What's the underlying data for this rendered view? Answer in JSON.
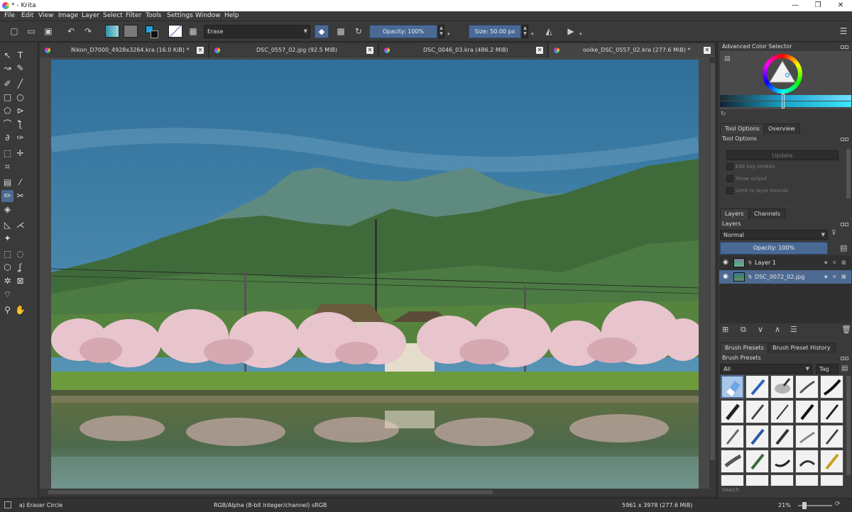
{
  "window": {
    "title": "* - Krita",
    "minimize": "—",
    "maximize": "❐",
    "close": "✕"
  },
  "menu": [
    "File",
    "Edit",
    "View",
    "Image",
    "Layer",
    "Select",
    "Filter",
    "Tools",
    "Settings",
    "Window",
    "Help"
  ],
  "toolbar": {
    "blend_mode": "Erase",
    "opacity": "Opacity: 100%",
    "size": "Size: 50.00 px"
  },
  "tabs": [
    {
      "label": "Nikon_D7000_4928x3264.kra (16.0 KiB) *"
    },
    {
      "label": "DSC_0557_02.jpg (92.5 MiB)"
    },
    {
      "label": "DSC_0046_03.kra (486.2 MiB)"
    },
    {
      "label": "ooike_DSC_0557_02.kra (277.6 MiB) *"
    }
  ],
  "color_selector": {
    "title": "Advanced Color Selector"
  },
  "tool_options": {
    "tabs": [
      "Tool Options",
      "Overview"
    ],
    "title": "Tool Options",
    "update_button": "Update",
    "options": [
      "Edit key strokes",
      "Show output",
      "Limit to layer bounds"
    ]
  },
  "layers": {
    "tabs": [
      "Layers",
      "Channels"
    ],
    "title": "Layers",
    "blend_mode": "Normal",
    "opacity": "Opacity:  100%",
    "items": [
      {
        "name": "Layer 1",
        "selected": false
      },
      {
        "name": "DSC_0072_02.jpg",
        "selected": true
      }
    ]
  },
  "brush_presets": {
    "tabs": [
      "Brush Presets",
      "Brush Preset History"
    ],
    "title": "Brush Presets",
    "filter": "All",
    "tag_button": "Tag",
    "search_placeholder": "Search"
  },
  "status": {
    "tool": "a) Eraser Circle",
    "color_space": "RGB/Alpha (8-bit integer/channel)  sRGB",
    "image_size": "5961 x 3978 (277.6 MiB)",
    "zoom": "21%"
  },
  "colors": {
    "accent": "#4d6a92",
    "panel": "#3a3a3a",
    "canvas_bg": "#474747"
  }
}
